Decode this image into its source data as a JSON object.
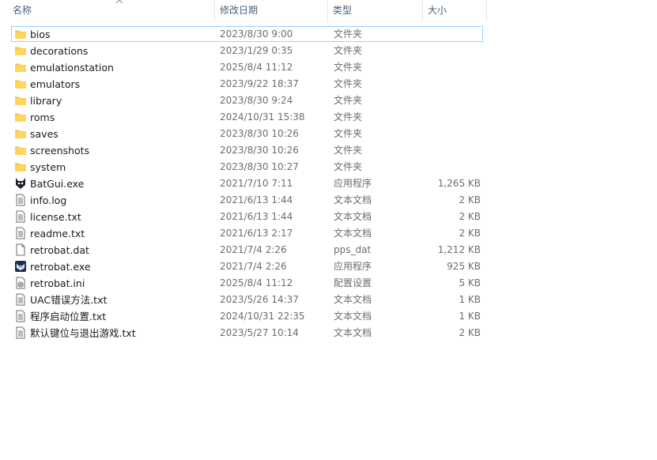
{
  "columns": {
    "name": "名称",
    "date": "修改日期",
    "type": "类型",
    "size": "大小"
  },
  "files": [
    {
      "name": "bios",
      "date": "2023/8/30 9:00",
      "type": "文件夹",
      "size": "",
      "icon": "folder-icon",
      "selected": true
    },
    {
      "name": "decorations",
      "date": "2023/1/29 0:35",
      "type": "文件夹",
      "size": "",
      "icon": "folder-icon"
    },
    {
      "name": "emulationstation",
      "date": "2025/8/4 11:12",
      "type": "文件夹",
      "size": "",
      "icon": "folder-icon"
    },
    {
      "name": "emulators",
      "date": "2023/9/22 18:37",
      "type": "文件夹",
      "size": "",
      "icon": "folder-icon"
    },
    {
      "name": "library",
      "date": "2023/8/30 9:24",
      "type": "文件夹",
      "size": "",
      "icon": "folder-icon"
    },
    {
      "name": "roms",
      "date": "2024/10/31 15:38",
      "type": "文件夹",
      "size": "",
      "icon": "folder-icon"
    },
    {
      "name": "saves",
      "date": "2023/8/30 10:26",
      "type": "文件夹",
      "size": "",
      "icon": "folder-icon"
    },
    {
      "name": "screenshots",
      "date": "2023/8/30 10:26",
      "type": "文件夹",
      "size": "",
      "icon": "folder-icon"
    },
    {
      "name": "system",
      "date": "2023/8/30 10:27",
      "type": "文件夹",
      "size": "",
      "icon": "folder-icon"
    },
    {
      "name": "BatGui.exe",
      "date": "2021/7/10 7:11",
      "type": "应用程序",
      "size": "1,265 KB",
      "icon": "batgui-app-icon"
    },
    {
      "name": "info.log",
      "date": "2021/6/13 1:44",
      "type": "文本文档",
      "size": "2 KB",
      "icon": "text-file-icon"
    },
    {
      "name": "license.txt",
      "date": "2021/6/13 1:44",
      "type": "文本文档",
      "size": "2 KB",
      "icon": "text-file-icon"
    },
    {
      "name": "readme.txt",
      "date": "2021/6/13 2:17",
      "type": "文本文档",
      "size": "2 KB",
      "icon": "text-file-icon"
    },
    {
      "name": "retrobat.dat",
      "date": "2021/7/4 2:26",
      "type": "pps_dat",
      "size": "1,212 KB",
      "icon": "blank-file-icon"
    },
    {
      "name": "retrobat.exe",
      "date": "2021/7/4 2:26",
      "type": "应用程序",
      "size": "925 KB",
      "icon": "retrobat-app-icon"
    },
    {
      "name": "retrobat.ini",
      "date": "2025/8/4 11:12",
      "type": "配置设置",
      "size": "5 KB",
      "icon": "settings-file-icon"
    },
    {
      "name": "UAC错误方法.txt",
      "date": "2023/5/26 14:37",
      "type": "文本文档",
      "size": "1 KB",
      "icon": "text-file-icon"
    },
    {
      "name": "程序启动位置.txt",
      "date": "2024/10/31 22:35",
      "type": "文本文档",
      "size": "1 KB",
      "icon": "text-file-icon"
    },
    {
      "name": "默认键位与退出游戏.txt",
      "date": "2023/5/27 10:14",
      "type": "文本文档",
      "size": "2 KB",
      "icon": "text-file-icon"
    }
  ],
  "colors": {
    "folder": "#ffd65c",
    "header_text": "#4c607a",
    "selection_border": "#99d1ff"
  }
}
